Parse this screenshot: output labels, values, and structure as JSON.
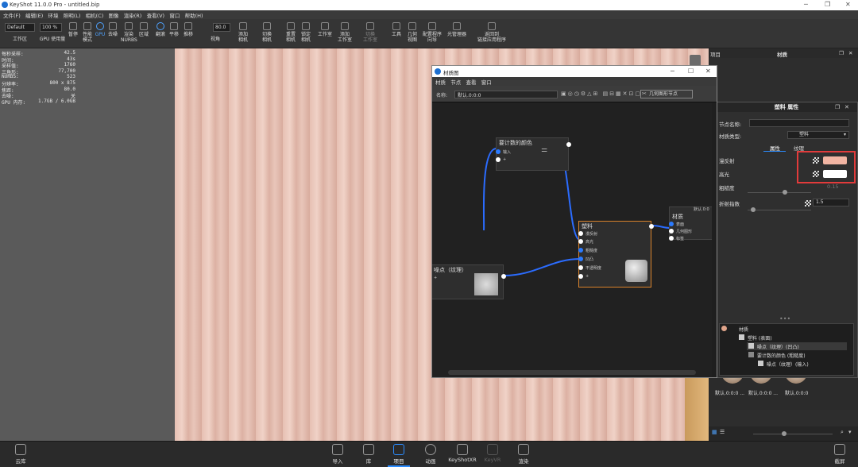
{
  "app": {
    "title": "KeyShot 11.0.0 Pro  - untitled.bip"
  },
  "menu": [
    "文件(F)",
    "编辑(E)",
    "环境",
    "照明(L)",
    "相机(C)",
    "图像",
    "渲染(R)",
    "查看(V)",
    "窗口",
    "帮助(H)"
  ],
  "toolbar": {
    "preset": "Default",
    "zoom": "100 %",
    "fov": "80.0",
    "groups": [
      {
        "label": "工作区"
      },
      {
        "label": "GPU 使用量"
      },
      {
        "label": "暂停"
      },
      {
        "label": "性能\n模式"
      },
      {
        "label": "GPU"
      },
      {
        "label": "去噪"
      },
      {
        "label": "渲染\nNURBS"
      },
      {
        "label": "区域"
      },
      {
        "label": "翻滚"
      },
      {
        "label": "平移"
      },
      {
        "label": "推移"
      },
      {
        "label": "视角"
      },
      {
        "label": "添加\n相机"
      },
      {
        "label": "切换\n相机"
      },
      {
        "label": "重置\n相机"
      },
      {
        "label": "锁定\n相机"
      },
      {
        "label": "工作室"
      },
      {
        "label": "添加\n工作室"
      },
      {
        "label": "切换\n工作室"
      },
      {
        "label": "工具"
      },
      {
        "label": "几何\n视图"
      },
      {
        "label": "配置程序\n向导"
      },
      {
        "label": "光管理器"
      },
      {
        "label": "返回到\n链接应用程序"
      }
    ]
  },
  "stats": [
    {
      "k": "每秒采样:",
      "v": "42.5"
    },
    {
      "k": "时间:",
      "v": "43s"
    },
    {
      "k": "采样值:",
      "v": "1760"
    },
    {
      "k": "三角形:",
      "v": "77,700"
    },
    {
      "k": "NURBS:",
      "v": "523"
    },
    {
      "k": "分辨率:",
      "v": "800 x 875"
    },
    {
      "k": "焦距:",
      "v": "80.0"
    },
    {
      "k": "去噪:",
      "v": "关"
    },
    {
      "k": "GPU 内存:",
      "v": "1.7GB / 6.0GB"
    }
  ],
  "material_window": {
    "title": "材质图",
    "menu": [
      "材质",
      "节点",
      "查看",
      "窗口"
    ],
    "name_label": "名称:",
    "name_value": "默认.0:0:0",
    "geometry_button": "几何图形节点",
    "nodes": {
      "color_node": {
        "title": "要计数的颜色",
        "pins": [
          "输入",
          "+"
        ]
      },
      "noise_node": {
        "title": "噪点（纹理）",
        "pins": [
          "+"
        ]
      },
      "plastic_node": {
        "title": "塑料",
        "pins": [
          "漫反射",
          "高光",
          "粗糙度",
          "凹凸",
          "不透明度",
          "+"
        ]
      },
      "material_node": {
        "title": "材质",
        "header": "默认.0:0",
        "pins": [
          "表面",
          "几何图形",
          "标签"
        ]
      }
    }
  },
  "right_panel": {
    "tabs": [
      "项目",
      "材质"
    ],
    "prop_title": "塑料 属性",
    "node_name_label": "节点名称:",
    "node_name_value": "",
    "material_type_label": "材质类型:",
    "material_type_value": "塑料",
    "subtabs": [
      "属性",
      "纹理"
    ],
    "diffuse_label": "漫反射",
    "diffuse_color": "#f2b5a3",
    "specular_label": "高光",
    "specular_color": "#ffffff",
    "roughness_label": "粗糙度",
    "roughness_value": "0.15",
    "ior_label": "折射指数",
    "ior_value": "1.5",
    "tree": [
      {
        "label": "材质"
      },
      {
        "label": "塑料 (表面)"
      },
      {
        "label": "噪点（纹理）(凹凸)"
      },
      {
        "label": "要计数的颜色 (粗糙度)"
      },
      {
        "label": "噪点（纹理）(输入)"
      }
    ],
    "thumbs": [
      "默认.0:0:0 ...",
      "默认.0:0:0 ...",
      "默认.0:0:0"
    ]
  },
  "bottom": {
    "left": "云库",
    "right": "截屏",
    "items": [
      {
        "label": "导入",
        "active": false
      },
      {
        "label": "库",
        "active": false
      },
      {
        "label": "项目",
        "active": true
      },
      {
        "label": "动画",
        "active": false
      },
      {
        "label": "KeyShotXR",
        "active": false
      },
      {
        "label": "KeyVR",
        "active": false
      },
      {
        "label": "渲染",
        "active": false
      }
    ]
  }
}
